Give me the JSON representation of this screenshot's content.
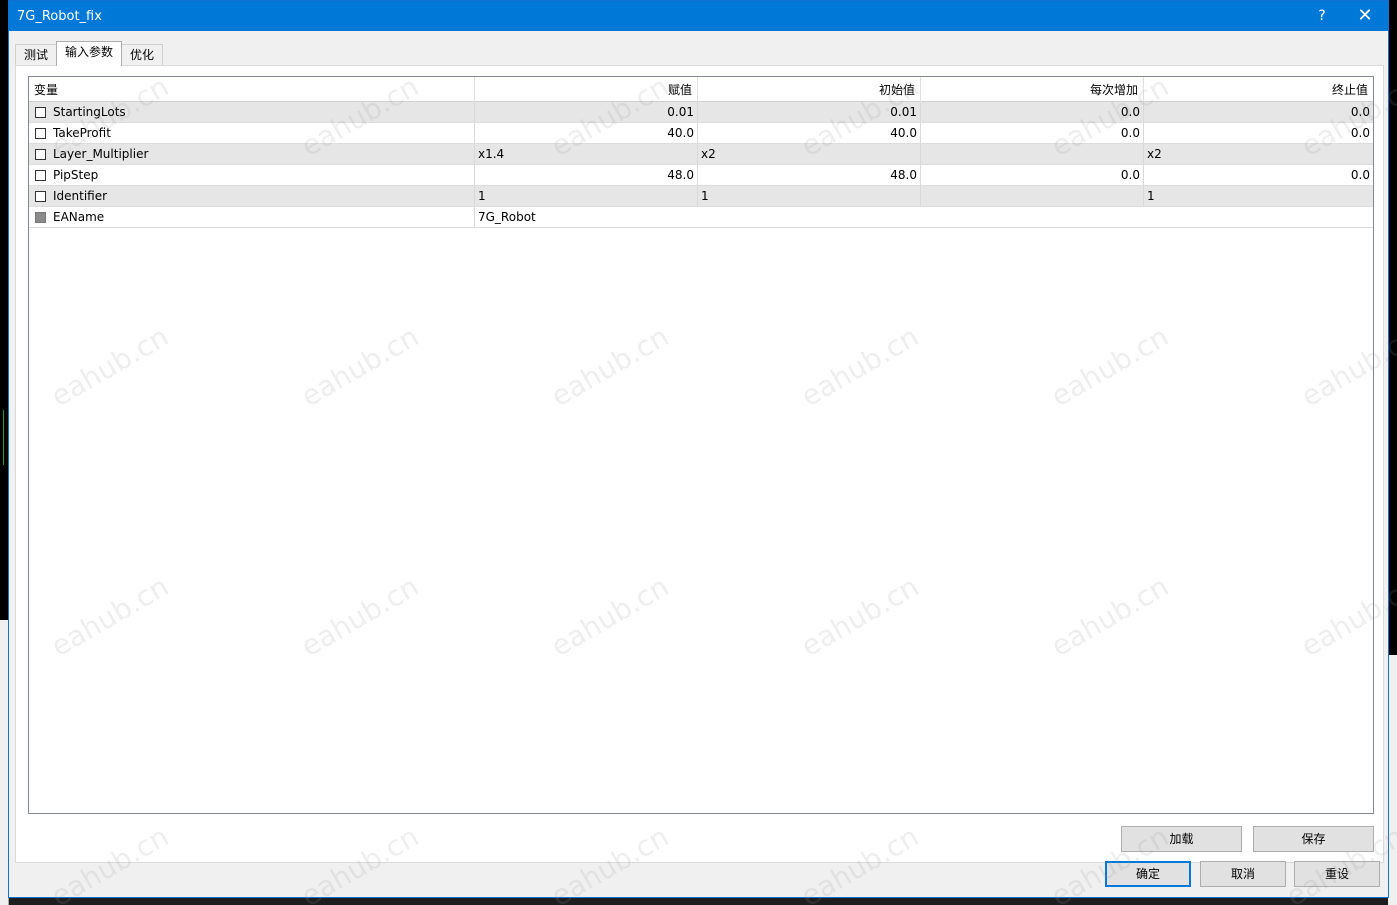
{
  "window": {
    "title": "7G_Robot_fix",
    "help_glyph": "?",
    "close_glyph": "✕"
  },
  "tabs": [
    {
      "label": "测试",
      "active": false
    },
    {
      "label": "输入参数",
      "active": true
    },
    {
      "label": "优化",
      "active": false
    }
  ],
  "columns": [
    "变量",
    "赋值",
    "初始值",
    "每次增加",
    "终止值"
  ],
  "rows": [
    {
      "name": "StartingLots",
      "value": "0.01",
      "start": "0.01",
      "step": "0.0",
      "stop": "0.0"
    },
    {
      "name": "TakeProfit",
      "value": "40.0",
      "start": "40.0",
      "step": "0.0",
      "stop": "0.0"
    },
    {
      "name": "Layer_Multiplier",
      "value": "x1.4",
      "start": "x2",
      "step": "",
      "stop": "x2"
    },
    {
      "name": "PipStep",
      "value": "48.0",
      "start": "48.0",
      "step": "0.0",
      "stop": "0.0"
    },
    {
      "name": "Identifier",
      "value": "1",
      "start": "1",
      "step": "",
      "stop": "1"
    },
    {
      "name": "EAName",
      "value": "7G_Robot"
    }
  ],
  "buttons": {
    "load": "加载",
    "save": "保存",
    "ok": "确定",
    "cancel": "取消",
    "reset": "重设"
  },
  "watermark": "eahub.cn",
  "colors": {
    "titlebar": "#0078d7",
    "alt_row": "#e6e6e6"
  }
}
